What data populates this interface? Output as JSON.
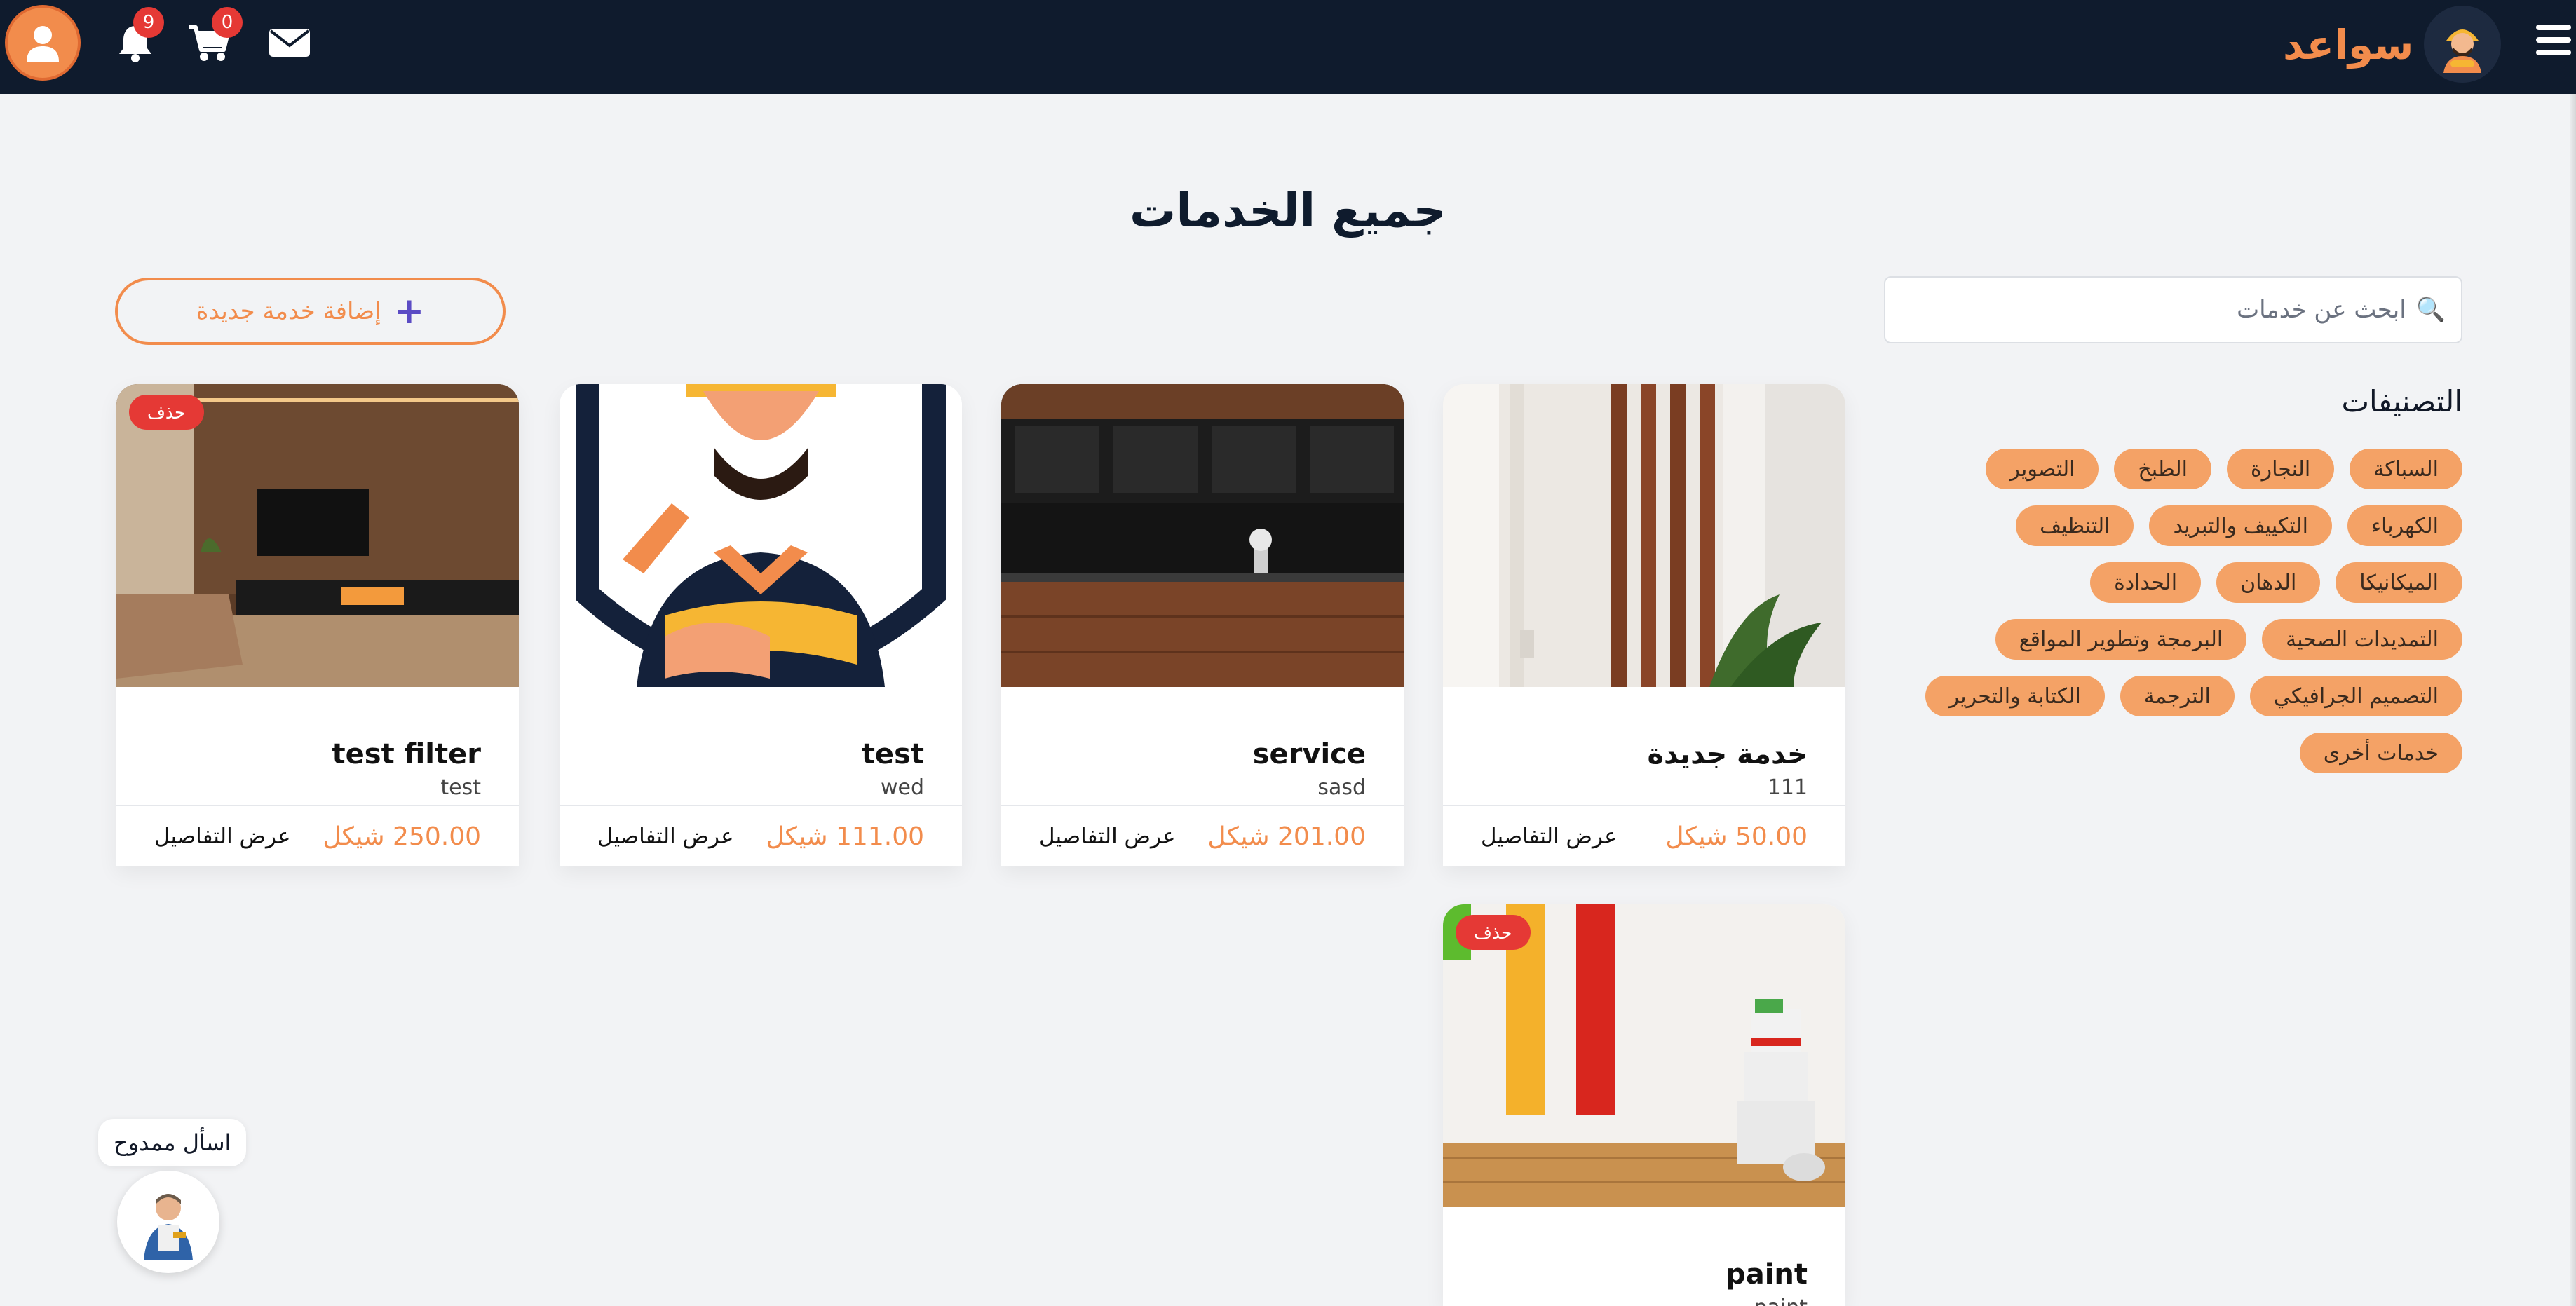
{
  "header": {
    "brand": "سواعد",
    "notifications_count": "9",
    "cart_count": "0"
  },
  "page": {
    "title": "جميع الخدمات",
    "add_button_label": "إضافة خدمة جديدة",
    "search_placeholder": "ابحث عن خدمات"
  },
  "categories": {
    "title": "التصنيفات",
    "items": [
      "السباكة",
      "النجارة",
      "الطبخ",
      "التصوير",
      "الكهرباء",
      "التكييف والتبريد",
      "التنظيف",
      "الميكانيكا",
      "الدهان",
      "الحدادة",
      "التمديدات الصحية",
      "البرمجة وتطوير المواقع",
      "التصميم الجرافيكي",
      "الترجمة",
      "الكتابة والتحرير",
      "خدمات أخرى"
    ]
  },
  "services": [
    {
      "name": "خدمة جديدة",
      "desc": "111",
      "price": "50.00 شيكل",
      "details": "عرض التفاصيل",
      "image": "wood-slats-photo"
    },
    {
      "name": "service",
      "desc": "sasd",
      "price": "201.00 شيكل",
      "details": "عرض التفاصيل",
      "image": "kitchen-photo"
    },
    {
      "name": "test",
      "desc": "wed",
      "price": "111.00 شيكل",
      "details": "عرض التفاصيل",
      "image": "worker-illustration"
    },
    {
      "name": "test filter",
      "desc": "test",
      "price": "250.00 شيكل",
      "details": "عرض التفاصيل",
      "image": "living-room-photo",
      "delete": "حذف"
    },
    {
      "name": "paint",
      "desc": "paint",
      "image": "paint-wall-photo",
      "delete": "حذف"
    }
  ],
  "chat": {
    "label": "اسأل ممدوح"
  },
  "colors": {
    "accent": "#f28c4c",
    "navbar": "#0f1b2d",
    "badge": "#e53935",
    "chip": "#f4a266"
  }
}
